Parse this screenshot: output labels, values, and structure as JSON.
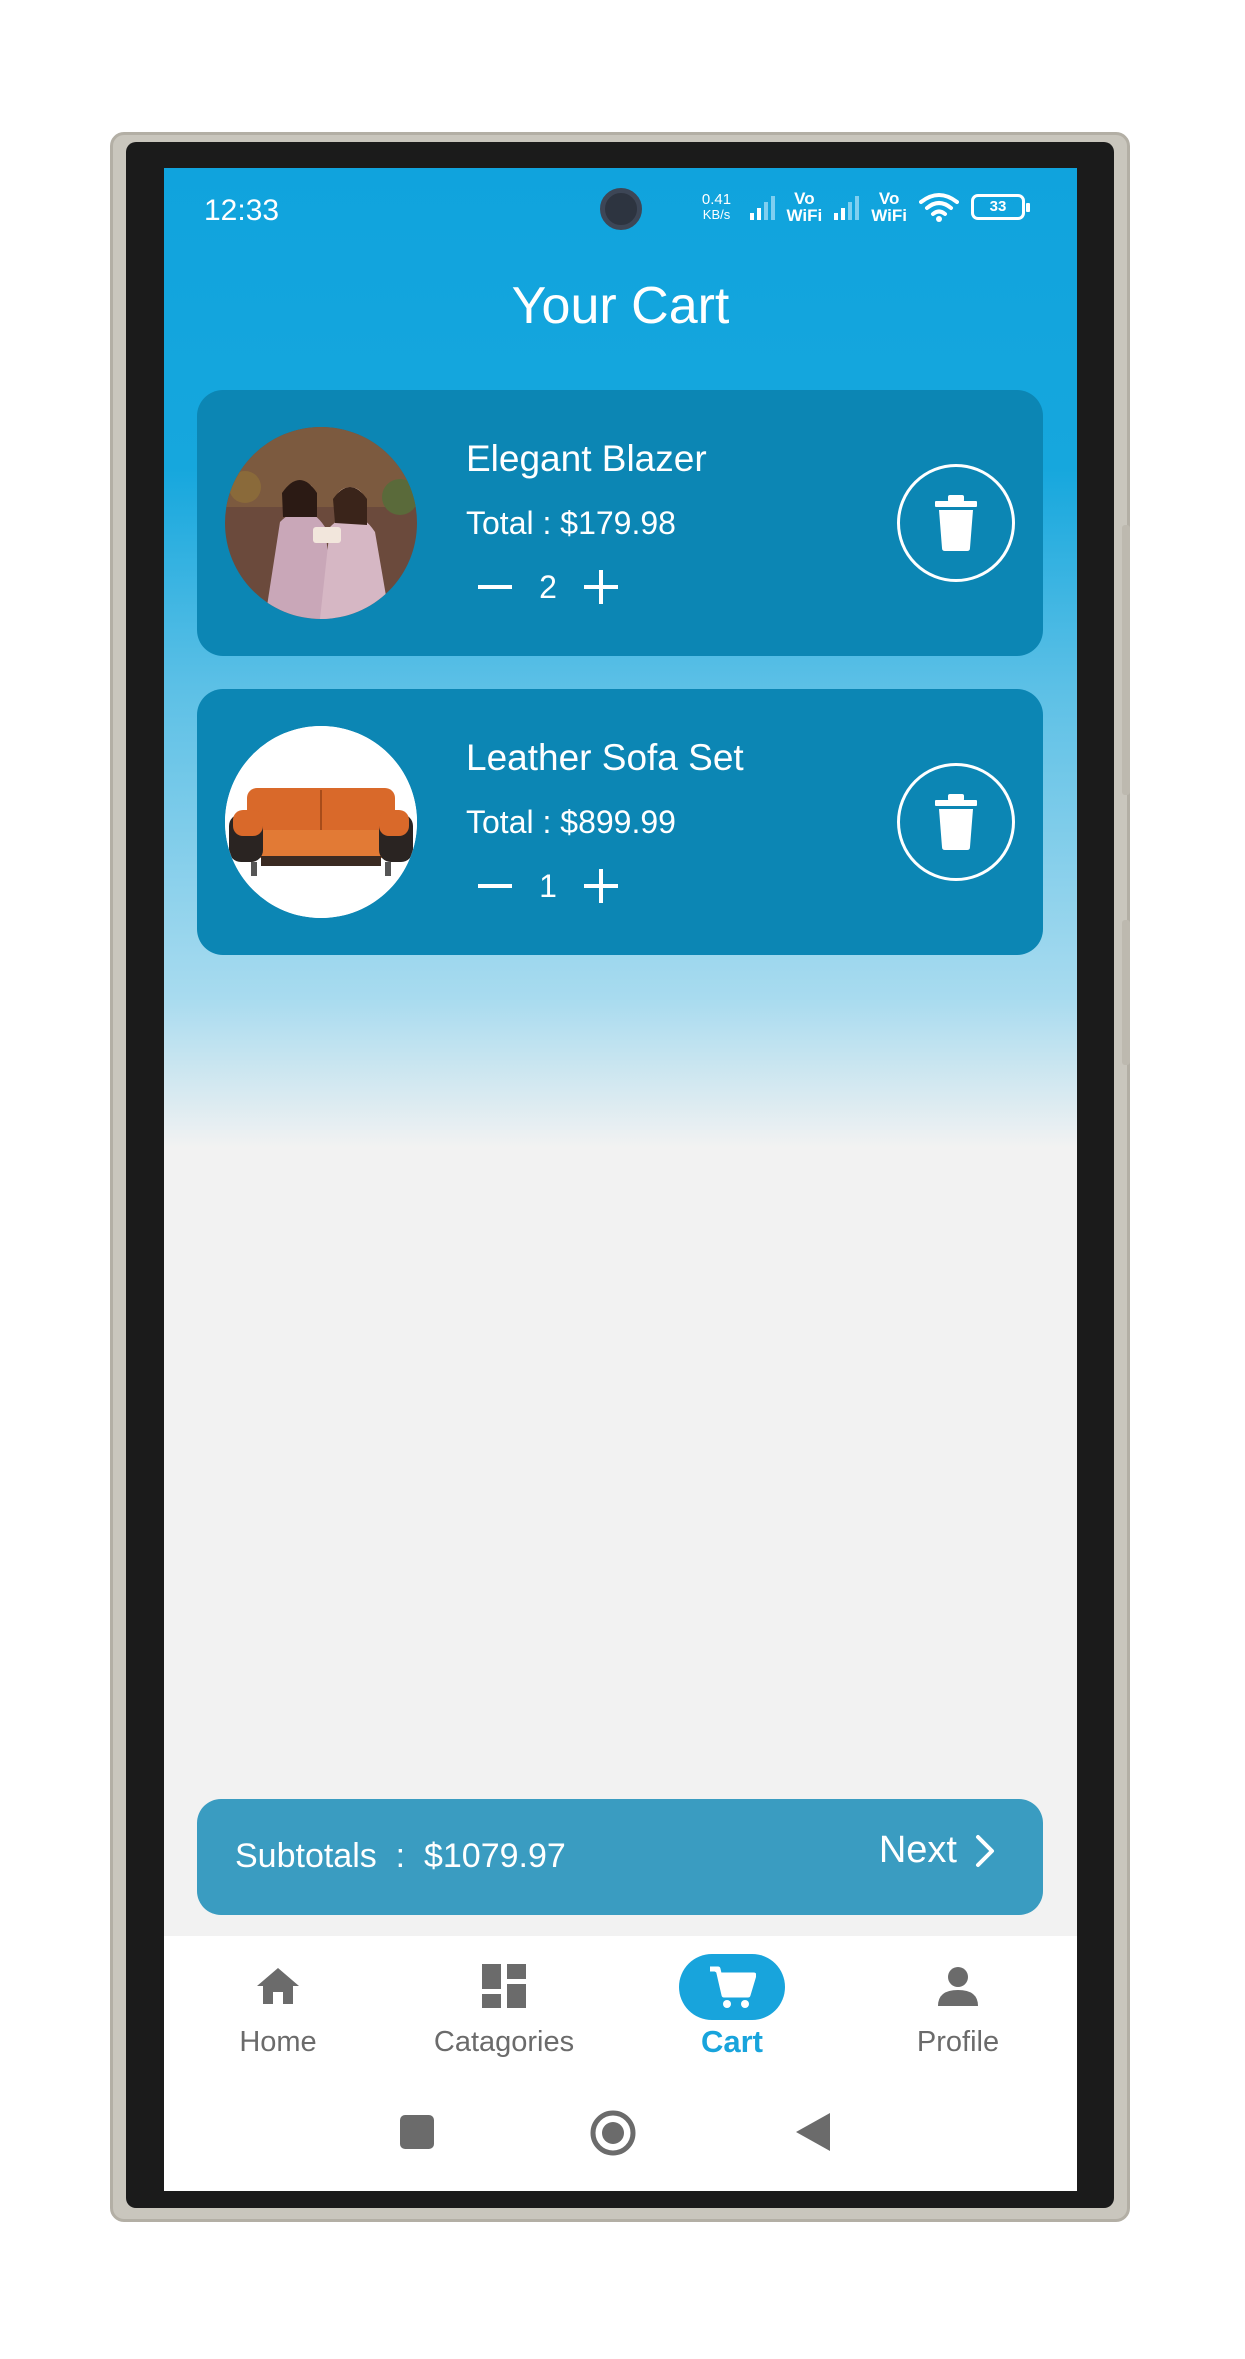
{
  "status_bar": {
    "time": "12:33",
    "net_speed_value": "0.41",
    "net_speed_unit": "KB/s",
    "sim1_label_top": "Vo",
    "sim1_label_bottom": "WiFi",
    "sim2_label_top": "Vo",
    "sim2_label_bottom": "WiFi",
    "battery_level": "33"
  },
  "header": {
    "title": "Your Cart"
  },
  "cart": {
    "items": [
      {
        "name": "Elegant Blazer",
        "total": "Total : $179.98",
        "quantity": "2",
        "image_icon": "dress-models-photo"
      },
      {
        "name": "Leather Sofa Set",
        "total": "Total : $899.99",
        "quantity": "1",
        "image_icon": "orange-sofa-photo"
      }
    ]
  },
  "subtotal": {
    "text": "Subtotals  :  $1079.97",
    "next_label": "Next"
  },
  "bottom_nav": {
    "items": [
      {
        "label": "Home",
        "icon": "home-icon",
        "active": false
      },
      {
        "label": "Catagories",
        "icon": "dashboard-icon",
        "active": false
      },
      {
        "label": "Cart",
        "icon": "cart-icon",
        "active": true
      },
      {
        "label": "Profile",
        "icon": "person-icon",
        "active": false
      }
    ]
  },
  "colors": {
    "accent": "#18a4dc",
    "card": "#0c86b4",
    "subtotal_bar": "#3a9cc1",
    "background": "#f2f2f2"
  }
}
